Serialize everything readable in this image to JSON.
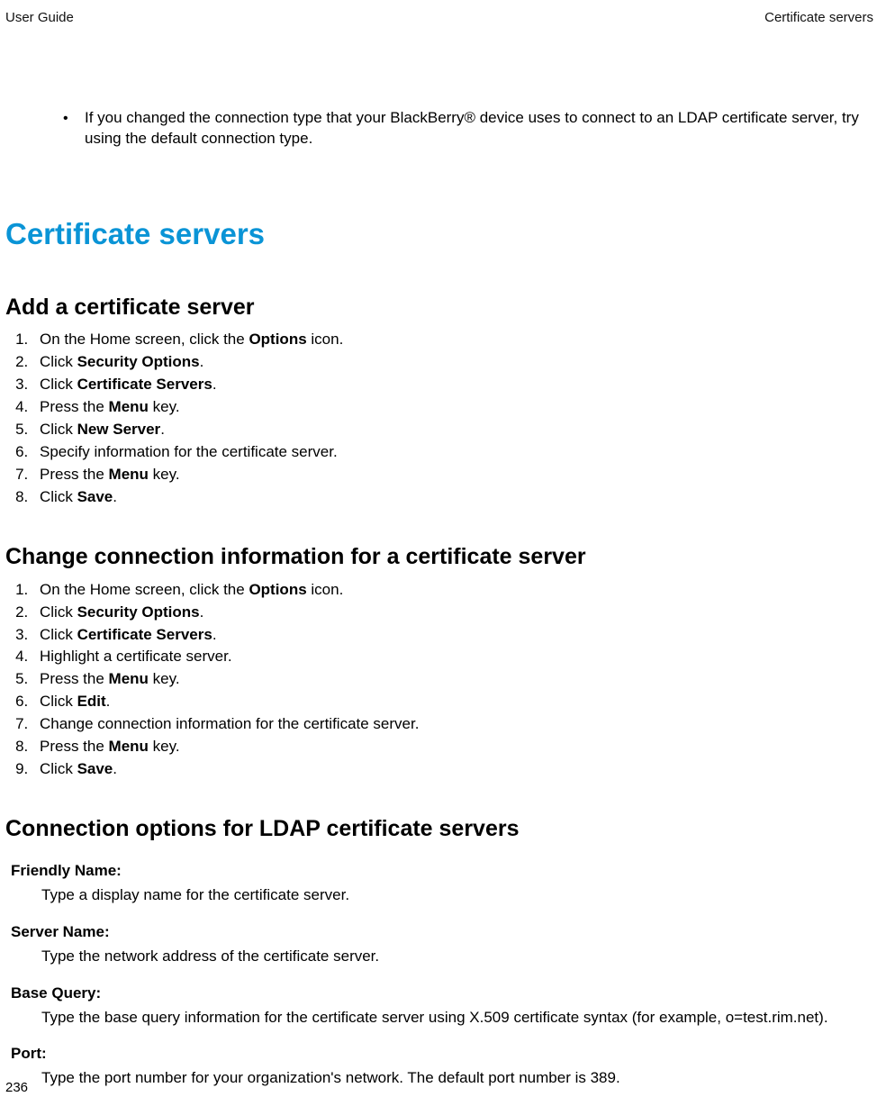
{
  "header": {
    "left": "User Guide",
    "right": "Certificate servers"
  },
  "intro": {
    "bullet": "•",
    "text": "If you changed the connection type that your BlackBerry® device uses to connect to an LDAP certificate server, try using the default connection type."
  },
  "mainTitle": "Certificate servers",
  "section1": {
    "title": "Add a certificate server",
    "steps": [
      {
        "pre": "On the Home screen, click the ",
        "bold": "Options",
        "post": " icon."
      },
      {
        "pre": "Click ",
        "bold": "Security Options",
        "post": "."
      },
      {
        "pre": "Click ",
        "bold": "Certificate Servers",
        "post": "."
      },
      {
        "pre": "Press the ",
        "bold": "Menu",
        "post": " key."
      },
      {
        "pre": "Click ",
        "bold": "New Server",
        "post": "."
      },
      {
        "pre": "Specify information for the certificate server.",
        "bold": "",
        "post": ""
      },
      {
        "pre": "Press the ",
        "bold": "Menu",
        "post": " key."
      },
      {
        "pre": "Click ",
        "bold": "Save",
        "post": "."
      }
    ]
  },
  "section2": {
    "title": "Change connection information for a certificate server",
    "steps": [
      {
        "pre": "On the Home screen, click the ",
        "bold": "Options",
        "post": " icon."
      },
      {
        "pre": "Click ",
        "bold": "Security Options",
        "post": "."
      },
      {
        "pre": "Click ",
        "bold": "Certificate Servers",
        "post": "."
      },
      {
        "pre": "Highlight a certificate server.",
        "bold": "",
        "post": ""
      },
      {
        "pre": "Press the ",
        "bold": "Menu",
        "post": " key."
      },
      {
        "pre": "Click ",
        "bold": "Edit",
        "post": "."
      },
      {
        "pre": "Change connection information for the certificate server.",
        "bold": "",
        "post": ""
      },
      {
        "pre": "Press the ",
        "bold": "Menu",
        "post": " key."
      },
      {
        "pre": "Click ",
        "bold": "Save",
        "post": "."
      }
    ]
  },
  "section3": {
    "title": "Connection options for LDAP certificate servers",
    "defs": [
      {
        "term": "Friendly Name",
        "desc": "Type a display name for the certificate server."
      },
      {
        "term": "Server Name",
        "desc": "Type the network address of the certificate server."
      },
      {
        "term": "Base Query",
        "desc": "Type the base query information for the certificate server using X.509 certificate syntax (for example, o=test.rim.net)."
      },
      {
        "term": "Port",
        "desc": "Type the port number for your organization's network. The default port number is 389."
      }
    ]
  },
  "pageNumber": "236"
}
